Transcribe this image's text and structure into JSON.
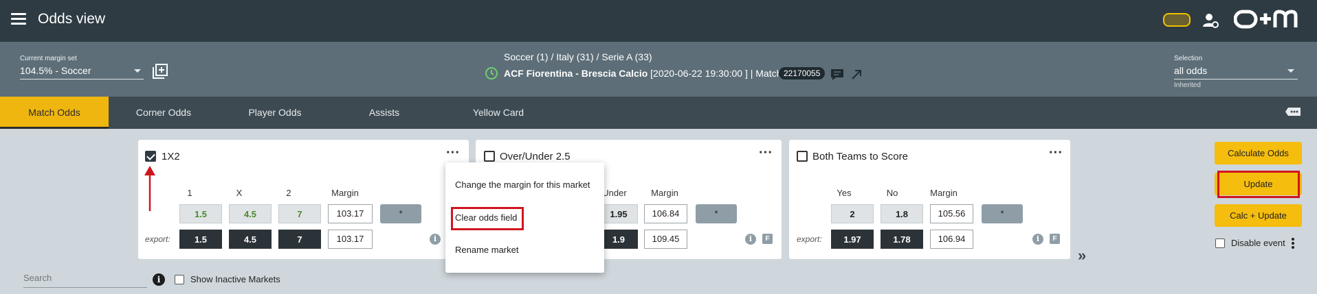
{
  "header": {
    "title": "Odds view",
    "menu_icon": "hamburger-icon",
    "user_icon": "user-settings-icon",
    "logo_text": "O+M",
    "toggle_color": "#f2c200"
  },
  "subheader": {
    "margin_set_label": "Current margin set",
    "margin_set_value": "104.5% - Soccer",
    "breadcrumb": "Soccer (1) / Italy (31) / Serie A (33)",
    "match_name": "ACF Fiorentina - Brescia Calcio",
    "match_time": " [2020-06-22 19:30:00 ] | Match ID",
    "match_id": "22170055",
    "selection_label": "Selection",
    "selection_value": "all odds",
    "inherited": "Inherited"
  },
  "tabs": [
    {
      "label": "Match Odds",
      "active": true
    },
    {
      "label": "Corner Odds",
      "active": false
    },
    {
      "label": "Player Odds",
      "active": false
    },
    {
      "label": "Assists",
      "active": false
    },
    {
      "label": "Yellow Card",
      "active": false
    }
  ],
  "markets": [
    {
      "title": "1X2",
      "checked": true,
      "columns": [
        "1",
        "X",
        "2",
        "Margin"
      ],
      "odds": [
        "1.5",
        "4.5",
        "7"
      ],
      "margin": "103.17",
      "export_label": "export:",
      "export_odds": [
        "1.5",
        "4.5",
        "7"
      ],
      "export_margin": "103.17",
      "star": "*"
    },
    {
      "title": "Over/Under 2.5",
      "checked": false,
      "columns": [
        "Under",
        "Margin"
      ],
      "odds": [
        "1.95"
      ],
      "margin": "106.84",
      "export_odds": [
        "1.9"
      ],
      "export_margin": "109.45",
      "star": "*"
    },
    {
      "title": "Both Teams to Score",
      "checked": false,
      "columns": [
        "Yes",
        "No",
        "Margin"
      ],
      "odds": [
        "2",
        "1.8"
      ],
      "margin": "105.56",
      "export_label": "export:",
      "export_odds": [
        "1.97",
        "1.78"
      ],
      "export_margin": "106.94",
      "star": "*"
    }
  ],
  "context_menu": {
    "items": [
      "Change the margin for this market",
      "Clear odds field",
      "Rename market"
    ]
  },
  "actions": {
    "calculate": "Calculate Odds",
    "update": "Update",
    "calc_update": "Calc + Update",
    "disable_event": "Disable event"
  },
  "search": {
    "placeholder": "Search",
    "show_inactive": "Show Inactive Markets"
  },
  "colors": {
    "accent": "#efb60f",
    "highlight": "#d0141e",
    "positive_odds": "#4a8a2c"
  }
}
